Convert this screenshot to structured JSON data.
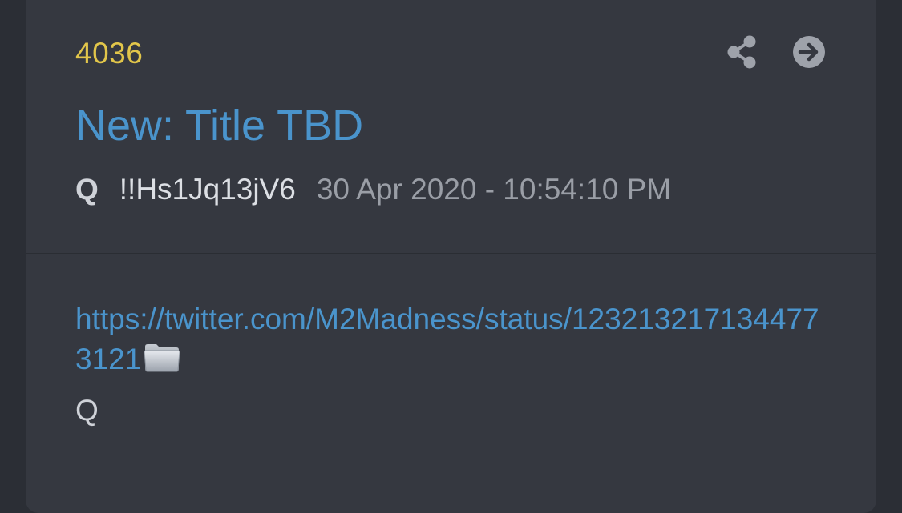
{
  "post": {
    "number": "4036",
    "title": "New: Title TBD",
    "author": "Q",
    "tripcode": "!!Hs1Jq13jV6",
    "timestamp": "30 Apr 2020 - 10:54:10 PM",
    "link_text": "https://twitter.com/M2Madness/status/1232132171344773121",
    "signature": "Q"
  },
  "icons": {
    "share": "share-icon",
    "open": "arrow-circle-right-icon",
    "folder": "folder-icon"
  },
  "colors": {
    "background": "#2b2e35",
    "card": "#353840",
    "post_number": "#e2c64a",
    "link": "#4a94cc",
    "text": "#cfd2d8",
    "muted": "#9a9ea6",
    "icon": "#9ea2aa"
  }
}
